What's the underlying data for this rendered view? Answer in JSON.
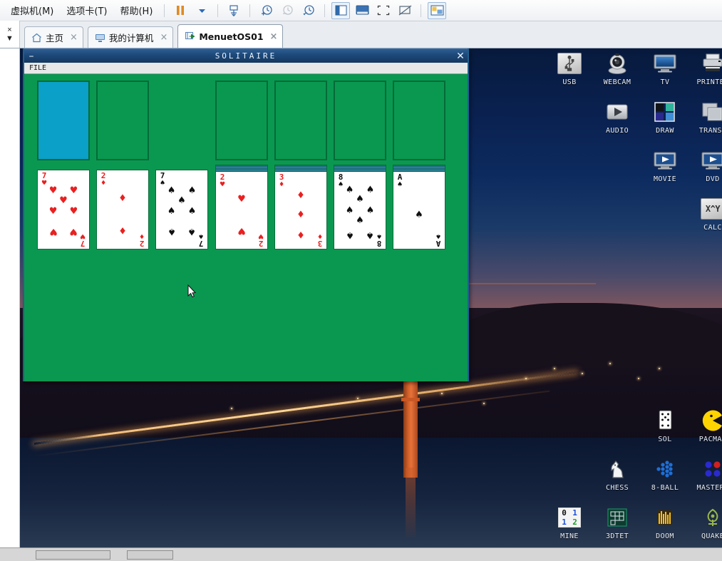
{
  "vmware": {
    "menus": [
      {
        "label": "虚拟机(M)",
        "name": "menu-virtual-machine"
      },
      {
        "label": "选项卡(T)",
        "name": "menu-tabs"
      },
      {
        "label": "帮助(H)",
        "name": "menu-help"
      }
    ],
    "toolbar": [
      {
        "name": "pause-button",
        "icon": "pause-icon"
      },
      {
        "name": "pause-dropdown",
        "icon": "chevron-down-icon"
      },
      {
        "name": "send-ctrl-alt-del-button",
        "icon": "keyboard-send-icon"
      },
      {
        "name": "take-snapshot-button",
        "icon": "clock-plus-icon"
      },
      {
        "name": "revert-snapshot-button",
        "icon": "clock-revert-icon"
      },
      {
        "name": "snapshot-manager-button",
        "icon": "clock-wrench-icon"
      },
      {
        "name": "show-library-button",
        "icon": "sidebar-panel-icon"
      },
      {
        "name": "show-console-view-button",
        "icon": "console-view-icon"
      },
      {
        "name": "fullscreen-button",
        "icon": "fullscreen-icon"
      },
      {
        "name": "unity-mode-button",
        "icon": "unity-mode-icon"
      },
      {
        "name": "show-thumbnail-bar-button",
        "icon": "thumbnail-bar-icon"
      }
    ],
    "sidebar_controls": {
      "close_label": "×",
      "dropdown_label": "▼"
    },
    "tabs": [
      {
        "label": "主页",
        "icon": "home-icon",
        "active": false,
        "name": "tab-home"
      },
      {
        "label": "我的计算机",
        "icon": "computer-icon",
        "active": false,
        "name": "tab-my-computer"
      },
      {
        "label": "MenuetOS01",
        "icon": "vm-running-icon",
        "active": true,
        "name": "tab-menuetos01"
      }
    ],
    "tab_close_glyph": "×"
  },
  "solitaire": {
    "window_title": "SOLITAIRE",
    "minimize_glyph": "–",
    "close_glyph": "✕",
    "menu": [
      {
        "label": "FILE",
        "name": "solitaire-menu-file"
      }
    ],
    "felt_color": "#0a9850",
    "deck_back_color": "#0aa0c8",
    "foundations": [
      {
        "name": "stock-pile",
        "type": "deck-back"
      },
      {
        "name": "waste-pile",
        "type": "empty"
      },
      {
        "name": "foundation-1",
        "type": "empty"
      },
      {
        "name": "foundation-2",
        "type": "empty"
      },
      {
        "name": "foundation-3",
        "type": "empty"
      },
      {
        "name": "foundation-4",
        "type": "empty"
      }
    ],
    "tableau": [
      {
        "rank": "7",
        "suit": "♥",
        "color": "red",
        "pips": 7,
        "stacked": false,
        "name": "tableau-card-7-hearts"
      },
      {
        "rank": "2",
        "suit": "♦",
        "color": "red",
        "pips": 2,
        "stacked": false,
        "name": "tableau-card-2-diamonds"
      },
      {
        "rank": "7",
        "suit": "♠",
        "color": "black",
        "pips": 7,
        "stacked": false,
        "name": "tableau-card-7-spades"
      },
      {
        "rank": "2",
        "suit": "♥",
        "color": "red",
        "pips": 2,
        "stacked": true,
        "name": "tableau-card-2-hearts"
      },
      {
        "rank": "3",
        "suit": "♦",
        "color": "red",
        "pips": 3,
        "stacked": true,
        "name": "tableau-card-3-diamonds"
      },
      {
        "rank": "8",
        "suit": "♠",
        "color": "black",
        "pips": 8,
        "stacked": true,
        "name": "tableau-card-8-spades"
      },
      {
        "rank": "A",
        "suit": "♠",
        "color": "black",
        "pips": 1,
        "stacked": true,
        "name": "tableau-card-ace-spades"
      }
    ]
  },
  "desktop": {
    "icons_top": [
      {
        "label": "USB",
        "icon": "usb-icon",
        "col": 0,
        "row": 0
      },
      {
        "label": "WEBCAM",
        "icon": "webcam-icon",
        "col": 1,
        "row": 0
      },
      {
        "label": "TV",
        "icon": "tv-icon",
        "col": 2,
        "row": 0
      },
      {
        "label": "PRINTER",
        "icon": "printer-icon",
        "col": 3,
        "row": 0
      },
      {
        "label": "AUDIO",
        "icon": "audio-icon",
        "col": 1,
        "row": 1
      },
      {
        "label": "DRAW",
        "icon": "draw-icon",
        "col": 2,
        "row": 1
      },
      {
        "label": "TRANSP",
        "icon": "transp-icon",
        "col": 3,
        "row": 1
      },
      {
        "label": "MOVIE",
        "icon": "movie-icon",
        "col": 2,
        "row": 2
      },
      {
        "label": "DVD",
        "icon": "dvd-icon",
        "col": 3,
        "row": 2
      },
      {
        "label": "CALC",
        "icon": "calc-icon",
        "col": 3,
        "row": 3
      }
    ],
    "icons_bottom": [
      {
        "label": "SOL",
        "icon": "solitaire-icon",
        "col": 2,
        "row": 0
      },
      {
        "label": "PACMAN",
        "icon": "pacman-icon",
        "col": 3,
        "row": 0
      },
      {
        "label": "CHESS",
        "icon": "chess-knight-icon",
        "col": 1,
        "row": 1
      },
      {
        "label": "8-BALL",
        "icon": "eight-ball-icon",
        "col": 2,
        "row": 1
      },
      {
        "label": "MASTERM",
        "icon": "mastermind-icon",
        "col": 3,
        "row": 1
      },
      {
        "label": "MINE",
        "icon": "minesweeper-icon",
        "col": 0,
        "row": 2
      },
      {
        "label": "3DTET",
        "icon": "tetris-icon",
        "col": 1,
        "row": 2
      },
      {
        "label": "DOOM",
        "icon": "doom-icon",
        "col": 2,
        "row": 2
      },
      {
        "label": "QUAKE",
        "icon": "quake-icon",
        "col": 3,
        "row": 2
      }
    ],
    "calc_icon_text": "X^Y",
    "mine_cells": [
      "0",
      "1",
      "1",
      "2"
    ]
  }
}
